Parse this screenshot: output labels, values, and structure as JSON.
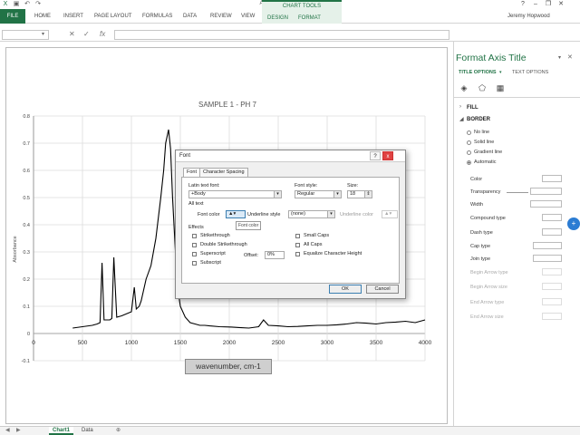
{
  "window": {
    "title": "All FTIR data.xlsx - Excel",
    "user": "Jeremy Hopwood"
  },
  "ribbon": {
    "file_tab": "FILE",
    "tabs": [
      "HOME",
      "INSERT",
      "PAGE LAYOUT",
      "FORMULAS",
      "DATA",
      "REVIEW",
      "VIEW"
    ],
    "contextual_group": "CHART TOOLS",
    "contextual_tabs": [
      "DESIGN",
      "FORMAT"
    ]
  },
  "formula_bar": {
    "fx": "fx",
    "value": ""
  },
  "chart_data": {
    "type": "line",
    "title": "SAMPLE 1 - PH 7",
    "xlabel": "wavenumber, cm-1",
    "ylabel": "Absorbance",
    "xlim": [
      0,
      4000
    ],
    "ylim": [
      -0.1,
      0.8
    ],
    "x_ticks": [
      "0",
      "500",
      "1000",
      "1500",
      "2000",
      "2500",
      "3000",
      "3500",
      "4000"
    ],
    "y_ticks": [
      "0.8",
      "0.7",
      "0.6",
      "0.5",
      "0.4",
      "0.3",
      "0.2",
      "0.1",
      "0",
      "-0.1"
    ],
    "grid": true,
    "series": [
      {
        "x": [
          400,
          500,
          600,
          650,
          680,
          700,
          720,
          780,
          800,
          820,
          850,
          900,
          1000,
          1030,
          1050,
          1080,
          1100,
          1150,
          1200,
          1250,
          1300,
          1330,
          1350,
          1380,
          1400,
          1420,
          1450,
          1480,
          1500,
          1550,
          1600,
          1650,
          1700,
          1750,
          1800,
          1900,
          2000,
          2100,
          2200,
          2300,
          2350,
          2400,
          2500,
          2600,
          2700,
          2800,
          2900,
          3000,
          3100,
          3200,
          3300,
          3400,
          3500,
          3600,
          3700,
          3800,
          3900,
          4000
        ],
        "y": [
          0.02,
          0.025,
          0.03,
          0.035,
          0.04,
          0.26,
          0.05,
          0.05,
          0.055,
          0.28,
          0.06,
          0.065,
          0.08,
          0.17,
          0.09,
          0.1,
          0.12,
          0.2,
          0.25,
          0.35,
          0.5,
          0.6,
          0.7,
          0.75,
          0.68,
          0.5,
          0.3,
          0.15,
          0.1,
          0.06,
          0.04,
          0.035,
          0.03,
          0.03,
          0.028,
          0.025,
          0.024,
          0.022,
          0.02,
          0.025,
          0.05,
          0.03,
          0.028,
          0.025,
          0.026,
          0.028,
          0.03,
          0.03,
          0.032,
          0.035,
          0.04,
          0.038,
          0.035,
          0.04,
          0.042,
          0.045,
          0.04,
          0.05
        ]
      }
    ]
  },
  "font_dialog": {
    "title": "Font",
    "help": "?",
    "close": "x",
    "tabs": [
      "Font",
      "Character Spacing"
    ],
    "latin_text_font_label": "Latin text font:",
    "latin_text_font_value": "+Body",
    "font_style_label": "Font style:",
    "font_style_value": "Regular",
    "size_label": "Size:",
    "size_value": "18",
    "all_text_label": "All text",
    "font_color_label": "Font color",
    "underline_style_label": "Underline style",
    "underline_style_value": "(none)",
    "underline_color_label": "Underline color",
    "tooltip": "Font color",
    "effects_label": "Effects",
    "effects_left": [
      "Strikethrough",
      "Double Strikethrough",
      "Superscript",
      "Subscript"
    ],
    "effects_right": [
      "Small Caps",
      "All Caps",
      "Equalize Character Height"
    ],
    "offset_label": "Offset:",
    "offset_value": "0%",
    "ok": "OK",
    "cancel": "Cancel"
  },
  "pane": {
    "title": "Format Axis Title",
    "tab_title_options": "TITLE OPTIONS",
    "tab_text_options": "TEXT OPTIONS",
    "fill": "FILL",
    "border": "BORDER",
    "border_options": [
      "No line",
      "Solid line",
      "Gradient line",
      "Automatic"
    ],
    "props": [
      "Color",
      "Transparency",
      "Width",
      "Compound type",
      "Dash type",
      "Cap type",
      "Join type",
      "Begin Arrow type",
      "Begin Arrow size",
      "End Arrow type",
      "End Arrow size"
    ]
  },
  "sheet_tabs": [
    "Chart1",
    "Data"
  ],
  "colors": {
    "excel_green": "#217346",
    "plot_line": "#000000"
  }
}
